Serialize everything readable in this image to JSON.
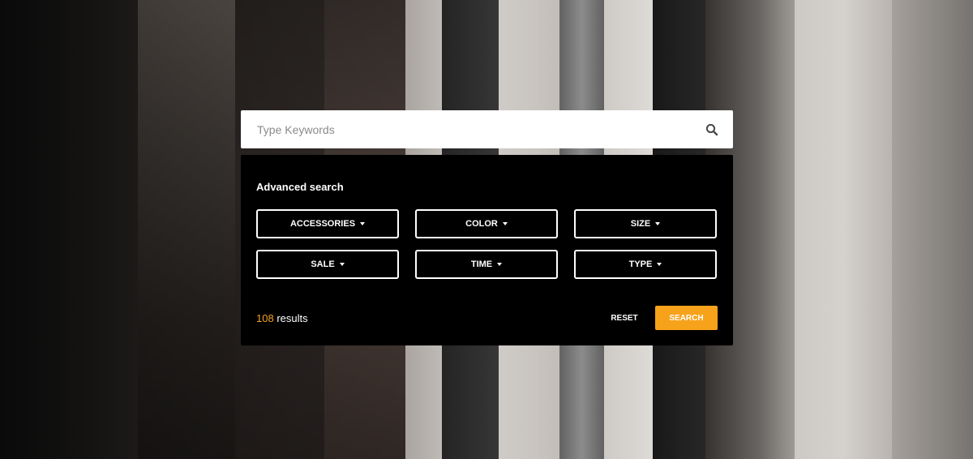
{
  "colors": {
    "accent": "#f7a21b",
    "panel_background": "#000000",
    "search_background": "#ffffff"
  },
  "search": {
    "placeholder": "Type Keywords",
    "value": "",
    "icon": "search-icon"
  },
  "advanced": {
    "title": "Advanced search",
    "filters": [
      {
        "label": "ACCESSORIES",
        "icon": "caret-down-icon"
      },
      {
        "label": "COLOR",
        "icon": "caret-down-icon"
      },
      {
        "label": "SIZE",
        "icon": "caret-down-icon"
      },
      {
        "label": "SALE",
        "icon": "caret-down-icon"
      },
      {
        "label": "TIME",
        "icon": "caret-down-icon"
      },
      {
        "label": "TYPE",
        "icon": "caret-down-icon"
      }
    ],
    "results_count": "108",
    "results_label": "results",
    "reset_label": "RESET",
    "search_label": "SEARCH"
  }
}
